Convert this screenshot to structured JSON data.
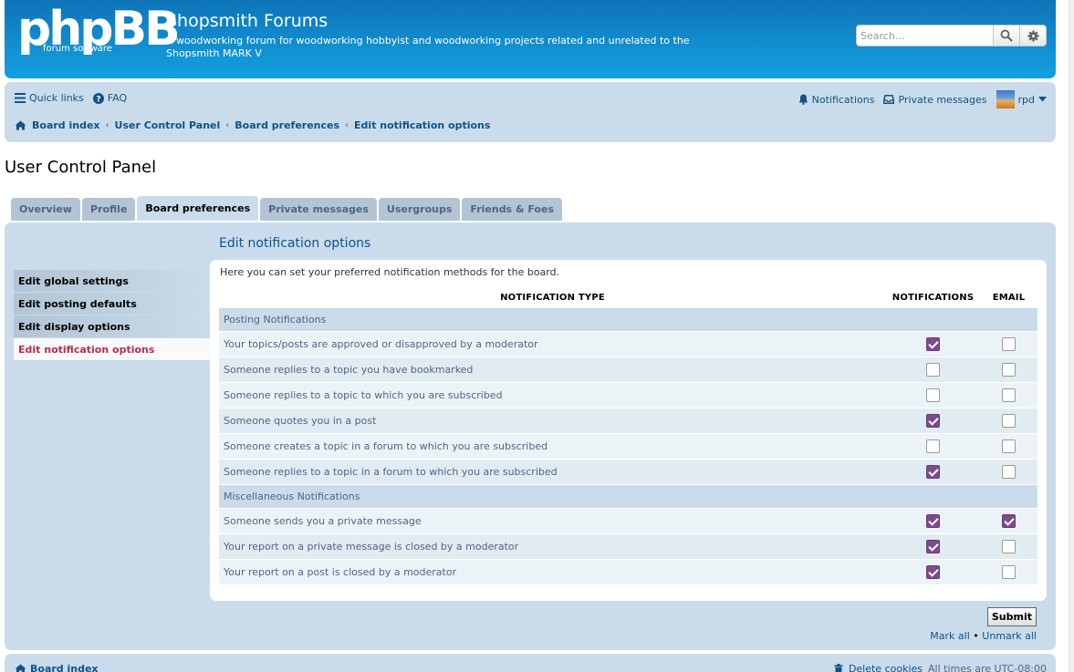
{
  "header": {
    "logo_main": "phpBB",
    "logo_sub": "forum software",
    "site_title": "Shopsmith Forums",
    "site_desc": "A woodworking forum for woodworking hobbyist and woodworking projects related and unrelated to the Shopsmith MARK V",
    "search_placeholder": "Search…"
  },
  "navbar": {
    "quick_links": "Quick links",
    "faq": "FAQ",
    "notifications": "Notifications",
    "private_messages": "Private messages",
    "username": "rpd",
    "breadcrumbs": [
      "Board index",
      "User Control Panel",
      "Board preferences",
      "Edit notification options"
    ]
  },
  "page_title": "User Control Panel",
  "tabs": [
    "Overview",
    "Profile",
    "Board preferences",
    "Private messages",
    "Usergroups",
    "Friends & Foes"
  ],
  "active_tab": 2,
  "sidebar": [
    "Edit global settings",
    "Edit posting defaults",
    "Edit display options",
    "Edit notification options"
  ],
  "panel_heading": "Edit notification options",
  "intro": "Here you can set your preferred notification methods for the board.",
  "table": {
    "headers": [
      "Notification type",
      "Notifications",
      "Email"
    ],
    "groups": [
      {
        "title": "Posting Notifications",
        "rows": [
          {
            "label": "Your topics/posts are approved or disapproved by a moderator",
            "notify": true,
            "email": false
          },
          {
            "label": "Someone replies to a topic you have bookmarked",
            "notify": false,
            "email": false
          },
          {
            "label": "Someone replies to a topic to which you are subscribed",
            "notify": false,
            "email": false
          },
          {
            "label": "Someone quotes you in a post",
            "notify": true,
            "email": false
          },
          {
            "label": "Someone creates a topic in a forum to which you are subscribed",
            "notify": false,
            "email": false
          },
          {
            "label": "Someone replies to a topic in a forum to which you are subscribed",
            "notify": true,
            "email": false
          }
        ]
      },
      {
        "title": "Miscellaneous Notifications",
        "rows": [
          {
            "label": "Someone sends you a private message",
            "notify": true,
            "email": true
          },
          {
            "label": "Your report on a private message is closed by a moderator",
            "notify": true,
            "email": false
          },
          {
            "label": "Your report on a post is closed by a moderator",
            "notify": true,
            "email": false
          }
        ]
      }
    ]
  },
  "submit_label": "Submit",
  "mark_all": "Mark all",
  "unmark_all": "Unmark all",
  "footer": {
    "board_index": "Board index",
    "delete_cookies": "Delete cookies",
    "times": "All times are UTC-08:00"
  },
  "colors": {
    "header": "#1288cc",
    "panel": "#cadceb",
    "checked": "#7c4b8b",
    "active_link": "#bc2a4d"
  }
}
